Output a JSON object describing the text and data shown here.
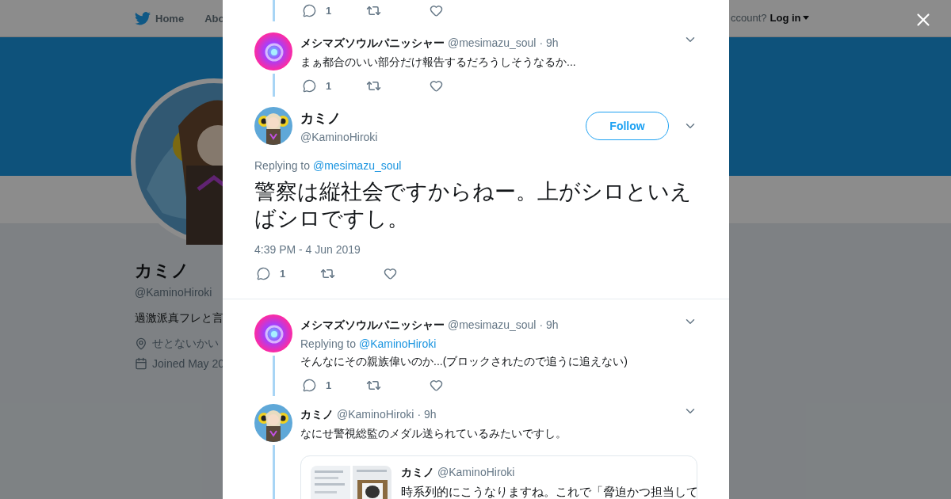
{
  "nav": {
    "home": "Home",
    "about": "Abo",
    "account_prompt": "ccount?",
    "login": "Log in"
  },
  "profile": {
    "name": "カミノ",
    "handle": "@KaminoHiroki",
    "bio": "過激派真フレと言",
    "location": "せとないかい",
    "joined": "Joined May 20"
  },
  "thread": {
    "top_actions": {
      "replies": "1"
    },
    "tweets": [
      {
        "kind": "reply",
        "name": "メシマズソウルパニッシャー",
        "handle": "@mesimazu_soul",
        "time": "· 9h",
        "text": "まぁ都合のいい部分だけ報告するだろうしそうなるか...",
        "replies": "1"
      },
      {
        "kind": "main",
        "name": "カミノ",
        "handle": "@KaminoHiroki",
        "follow": "Follow",
        "replying_label": "Replying to",
        "replying_to": "@mesimazu_soul",
        "text": "警察は縦社会ですからねー。上がシロといえばシロですし。",
        "timestamp": "4:39 PM - 4 Jun 2019",
        "replies": "1"
      },
      {
        "kind": "reply",
        "name": "メシマズソウルパニッシャー",
        "handle": "@mesimazu_soul",
        "time": "· 9h",
        "replying_label": "Replying to",
        "replying_to": "@KaminoHiroki",
        "text": "そんなにその親族偉いのか...(ブロックされたので追うに追えない)",
        "replies": "1"
      },
      {
        "kind": "reply",
        "name": "カミノ",
        "handle": "@KaminoHiroki",
        "time": "· 9h",
        "text": "なにせ警視総監のメダル送られているみたいですし。",
        "quote": {
          "name": "カミノ",
          "handle": "@KaminoHiroki",
          "text": "時系列的にこうなりますね。これで「脅迫かつ担当して"
        }
      }
    ]
  }
}
